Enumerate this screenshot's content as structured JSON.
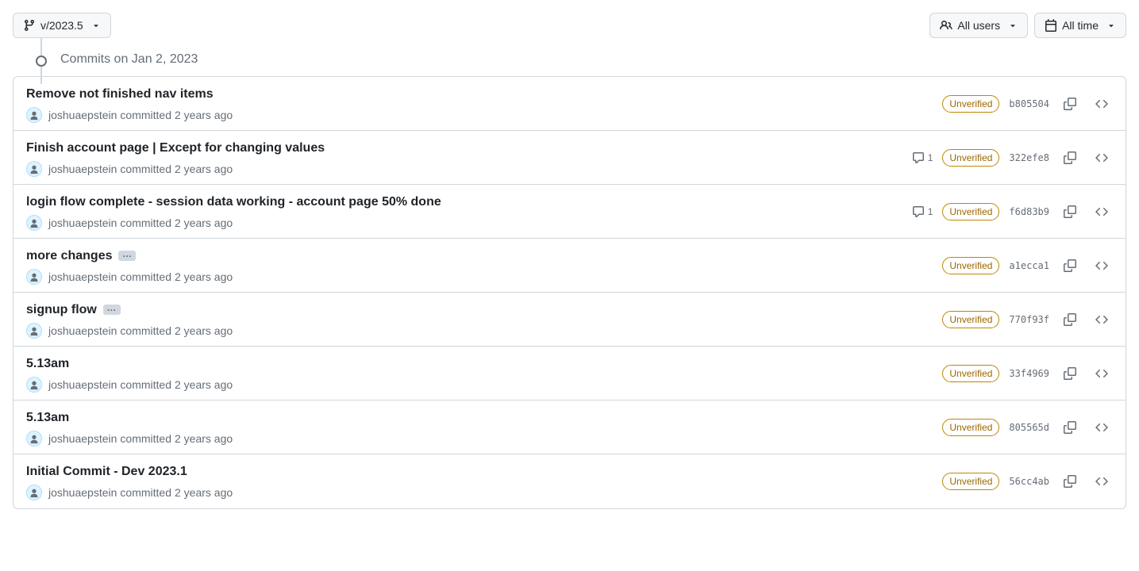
{
  "toolbar": {
    "branch_label": "v/2023.5",
    "users_filter_label": "All users",
    "time_filter_label": "All time"
  },
  "timeline": {
    "date_heading": "Commits on Jan 2, 2023"
  },
  "badges": {
    "unverified_label": "Unverified"
  },
  "commits": [
    {
      "title": "Remove not finished nav items",
      "author": "joshuaepstein",
      "action": "committed",
      "time": "2 years ago",
      "has_ellipsis": false,
      "comments": null,
      "verified": false,
      "sha": "b805504"
    },
    {
      "title": "Finish account page | Except for changing values",
      "author": "joshuaepstein",
      "action": "committed",
      "time": "2 years ago",
      "has_ellipsis": false,
      "comments": 1,
      "verified": false,
      "sha": "322efe8"
    },
    {
      "title": "login flow complete - session data working - account page 50% done",
      "author": "joshuaepstein",
      "action": "committed",
      "time": "2 years ago",
      "has_ellipsis": false,
      "comments": 1,
      "verified": false,
      "sha": "f6d83b9"
    },
    {
      "title": "more changes",
      "author": "joshuaepstein",
      "action": "committed",
      "time": "2 years ago",
      "has_ellipsis": true,
      "comments": null,
      "verified": false,
      "sha": "a1ecca1"
    },
    {
      "title": "signup flow",
      "author": "joshuaepstein",
      "action": "committed",
      "time": "2 years ago",
      "has_ellipsis": true,
      "comments": null,
      "verified": false,
      "sha": "770f93f"
    },
    {
      "title": "5.13am",
      "author": "joshuaepstein",
      "action": "committed",
      "time": "2 years ago",
      "has_ellipsis": false,
      "comments": null,
      "verified": false,
      "sha": "33f4969"
    },
    {
      "title": "5.13am",
      "author": "joshuaepstein",
      "action": "committed",
      "time": "2 years ago",
      "has_ellipsis": false,
      "comments": null,
      "verified": false,
      "sha": "805565d"
    },
    {
      "title": "Initial Commit - Dev 2023.1",
      "author": "joshuaepstein",
      "action": "committed",
      "time": "2 years ago",
      "has_ellipsis": false,
      "comments": null,
      "verified": false,
      "sha": "56cc4ab"
    }
  ]
}
